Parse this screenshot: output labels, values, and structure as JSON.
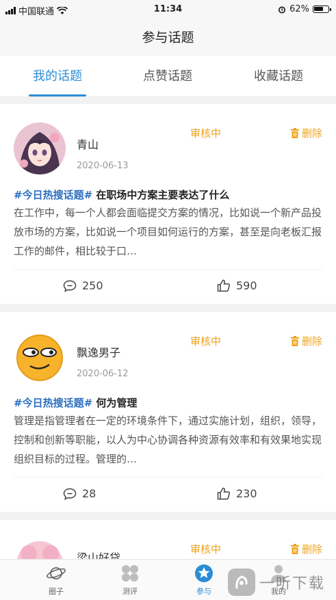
{
  "status_bar": {
    "carrier": "中国联通",
    "time": "11:34",
    "battery": "62%"
  },
  "nav": {
    "title": "参与话题"
  },
  "tabs": [
    {
      "label": "我的话题",
      "active": true
    },
    {
      "label": "点赞话题",
      "active": false
    },
    {
      "label": "收藏话题",
      "active": false
    }
  ],
  "posts": [
    {
      "username": "青山",
      "date": "2020-06-13",
      "status": "审核中",
      "delete_label": "删除",
      "tag": "#今日热搜话题#",
      "title": "在职场中方案主要表达了什么",
      "body": "在工作中，每一个人都会面临提交方案的情况，比如说一个新产品投放市场的方案，比如说一个项目如何运行的方案，甚至是向老板汇报工作的邮件，相比较于口…",
      "comments": "250",
      "likes": "590"
    },
    {
      "username": "飘逸男子",
      "date": "2020-06-12",
      "status": "审核中",
      "delete_label": "删除",
      "tag": "#今日热搜话题#",
      "title": "何为管理",
      "body": "管理是指管理者在一定的环境条件下，通过实施计划，组织，领导，控制和创新等职能，以人为中心协调各种资源有效率和有效果地实现组织目标的过程。管理的…",
      "comments": "28",
      "likes": "230"
    },
    {
      "username": "梁山好贷",
      "status": "审核中",
      "delete_label": "删除"
    }
  ],
  "tabbar": [
    {
      "label": "圈子",
      "icon": "planet-icon"
    },
    {
      "label": "测评",
      "icon": "grid-icon"
    },
    {
      "label": "参与",
      "icon": "star-badge-icon",
      "active": true
    },
    {
      "label": "我的",
      "icon": "person-icon"
    }
  ],
  "watermark": {
    "text": "一听下载"
  },
  "colors": {
    "accent": "#2c8cd6",
    "status": "#f0a21a",
    "tag": "#2c6fc2"
  }
}
